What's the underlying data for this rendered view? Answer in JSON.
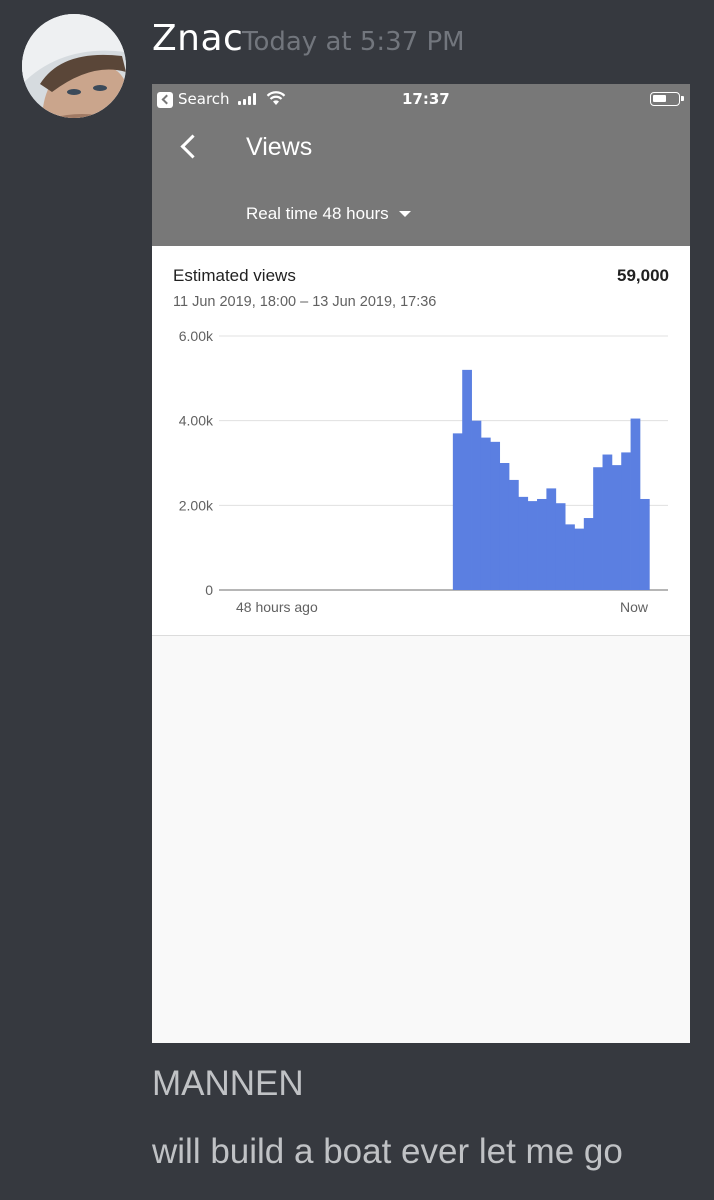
{
  "message": {
    "username": "Znac",
    "timestamp": "Today at 5:37 PM",
    "lines": [
      "MANNEN",
      "will build a boat ever let me go"
    ]
  },
  "phone": {
    "status": {
      "back_app": "Search",
      "time": "17:37"
    },
    "header": {
      "title": "Views",
      "range_label": "Real time 48 hours"
    },
    "card": {
      "metric_label": "Estimated views",
      "metric_value": "59,000",
      "date_range": "11 Jun 2019, 18:00 – 13 Jun 2019, 17:36"
    }
  },
  "colors": {
    "bar": "#5b7fe1",
    "bar_partial": "#aabcef",
    "appbar": "#787878",
    "discord_bg": "#36393f"
  },
  "chart_data": {
    "type": "bar",
    "y_ticks": [
      "6.00k",
      "4.00k",
      "2.00k",
      "0"
    ],
    "ylim": [
      0,
      6000
    ],
    "x_labels": [
      "48 hours ago",
      "Now"
    ],
    "buckets": 48,
    "values": [
      0,
      0,
      0,
      0,
      0,
      0,
      0,
      0,
      0,
      0,
      0,
      0,
      0,
      0,
      0,
      0,
      0,
      0,
      0,
      0,
      0,
      0,
      0,
      0,
      0,
      3700,
      5200,
      4000,
      3600,
      3500,
      3000,
      2600,
      2200,
      2100,
      2150,
      2400,
      2050,
      1550,
      1450,
      1700,
      2900,
      3200,
      2950,
      3250,
      4050,
      2150
    ],
    "partial_last": true,
    "grid": true
  },
  "icons": [
    "back-chevron-icon",
    "signal-icon",
    "wifi-icon",
    "battery-icon",
    "dropdown-caret-icon"
  ]
}
